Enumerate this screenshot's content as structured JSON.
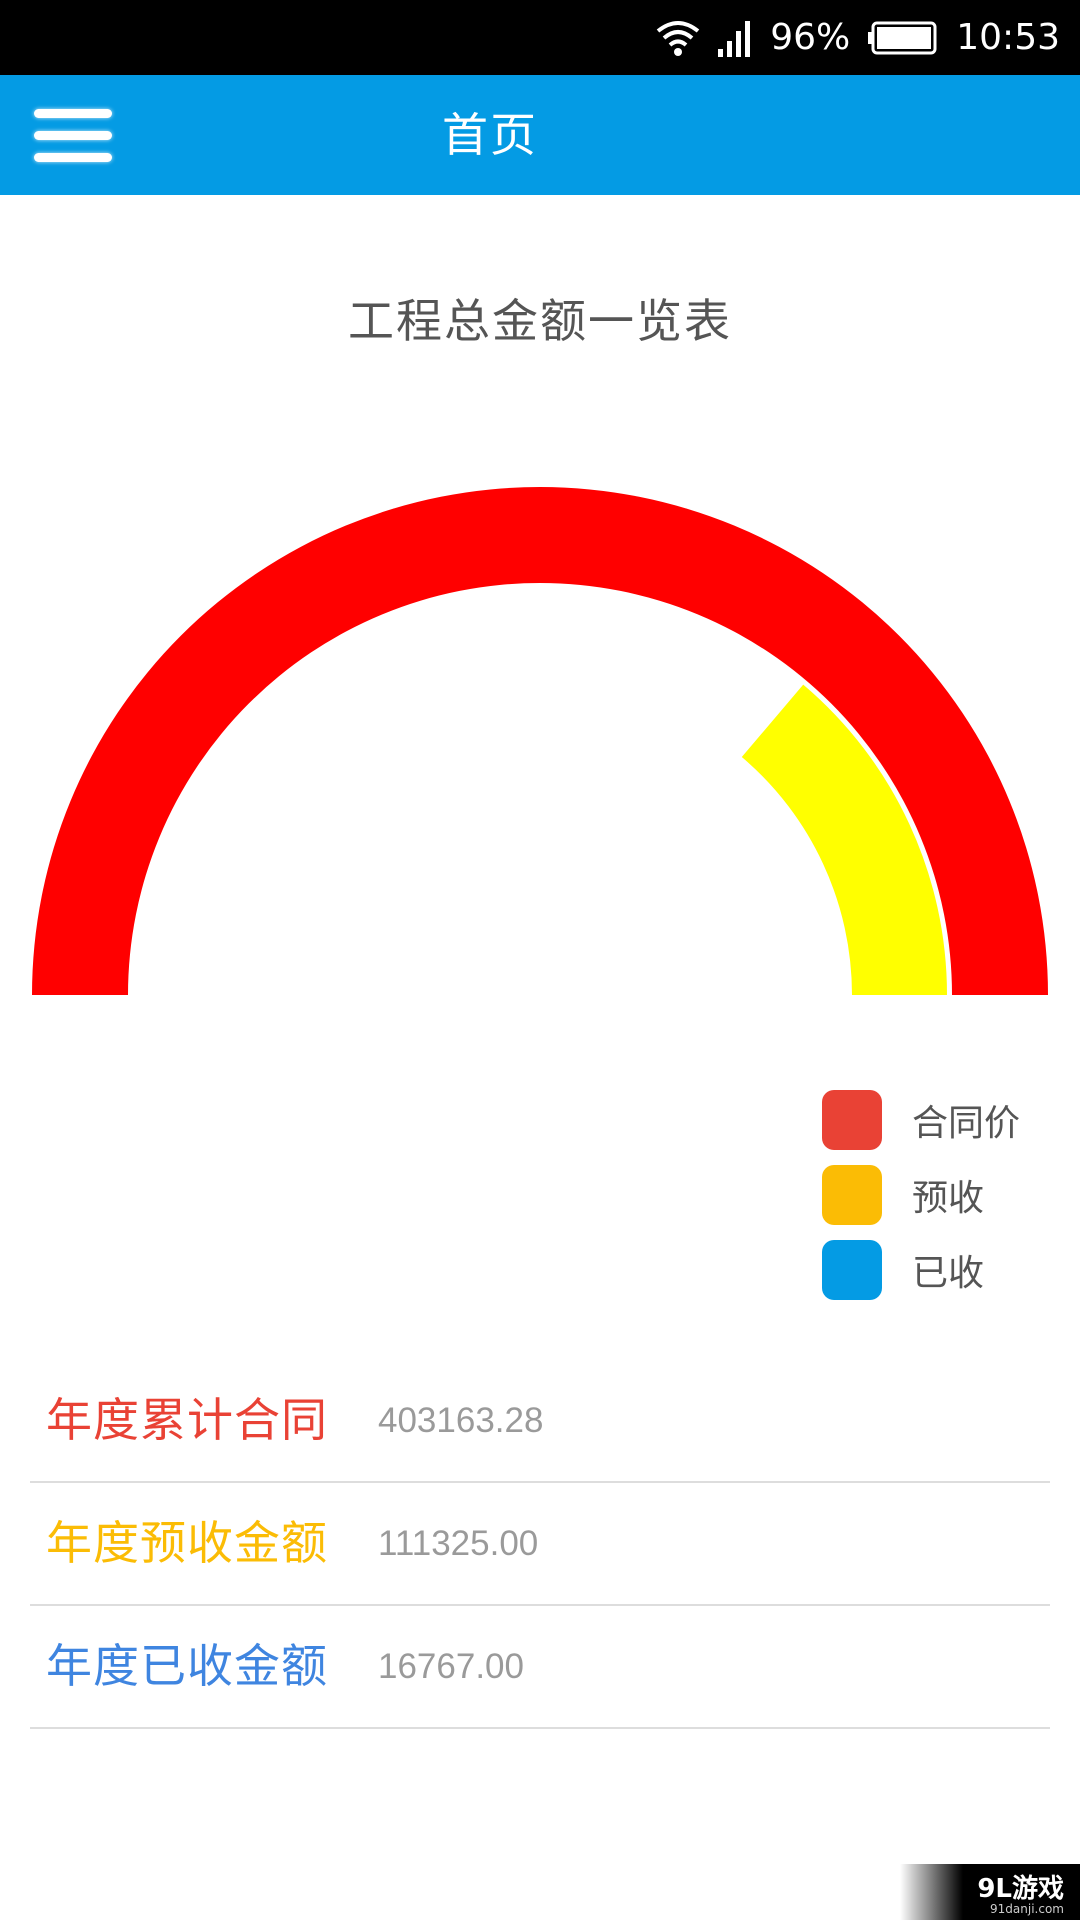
{
  "status_bar": {
    "battery_percent": "96%",
    "time": "10:53",
    "icons": [
      "wifi-icon",
      "signal-icon",
      "battery-icon"
    ]
  },
  "header": {
    "title": "首页",
    "menu_icon": "hamburger-menu-icon"
  },
  "colors": {
    "app_bar": "#049be4",
    "contract": "#e94235",
    "advance": "#fbbc05",
    "received": "#049be4",
    "gauge_contract": "#ff0000",
    "gauge_advance": "#ffff00"
  },
  "chart_data": {
    "type": "gauge",
    "title": "工程总金额一览表",
    "series": [
      {
        "name": "合同价",
        "value": 403163.28
      },
      {
        "name": "预收",
        "value": 111325.0
      },
      {
        "name": "已收",
        "value": 16767.0
      }
    ],
    "legend": {
      "placement": "bottom-right",
      "items": [
        {
          "label": "合同价",
          "color": "#e94235"
        },
        {
          "label": "预收",
          "color": "#fbbc05"
        },
        {
          "label": "已收",
          "color": "#049be4"
        }
      ]
    }
  },
  "stats": [
    {
      "label": "年度累计合同",
      "value": "403163.28",
      "color": "#e94235"
    },
    {
      "label": "年度预收金额",
      "value": "111325.00",
      "color": "#fbbc05"
    },
    {
      "label": "年度已收金额",
      "value": "16767.00",
      "color": "#3f85e0"
    }
  ],
  "watermark": {
    "main": "9L游戏",
    "sub": "91danji.com"
  }
}
